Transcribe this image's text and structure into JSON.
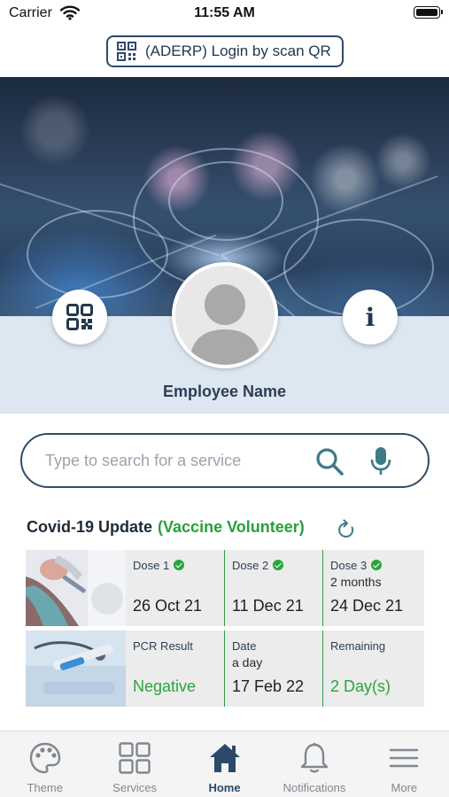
{
  "status_bar": {
    "carrier": "Carrier",
    "time": "11:55 AM"
  },
  "login_button": {
    "label": "(ADERP) Login by scan QR",
    "icon": "qr-code-icon"
  },
  "profile": {
    "employee_name": "Employee Name",
    "left_button_icon": "qr-code-icon",
    "right_button_icon": "info-icon"
  },
  "search": {
    "placeholder": "Type to search for a service",
    "value": ""
  },
  "covid": {
    "title": "Covid-19 Update",
    "status": "(Vaccine Volunteer)",
    "doses": [
      {
        "label": "Dose 1",
        "note": "",
        "date": "26 Oct 21"
      },
      {
        "label": "Dose 2",
        "note": "",
        "date": "11 Dec 21"
      },
      {
        "label": "Dose 3",
        "note": "2 months",
        "date": "24 Dec 21"
      }
    ],
    "pcr": {
      "result_label": "PCR Result",
      "result_value": "Negative",
      "date_label": "Date",
      "date_note": "a day",
      "date_value": "17 Feb 22",
      "remaining_label": "Remaining",
      "remaining_value": "2 Day(s)"
    }
  },
  "tabs": [
    {
      "label": "Theme",
      "icon": "palette-icon",
      "active": false
    },
    {
      "label": "Services",
      "icon": "grid-icon",
      "active": false
    },
    {
      "label": "Home",
      "icon": "home-icon",
      "active": true
    },
    {
      "label": "Notifications",
      "icon": "bell-icon",
      "active": false
    },
    {
      "label": "More",
      "icon": "menu-icon",
      "active": false
    }
  ],
  "colors": {
    "primary": "#2b4a6a",
    "accent_green": "#2aa43c",
    "band": "#dde7f1"
  }
}
